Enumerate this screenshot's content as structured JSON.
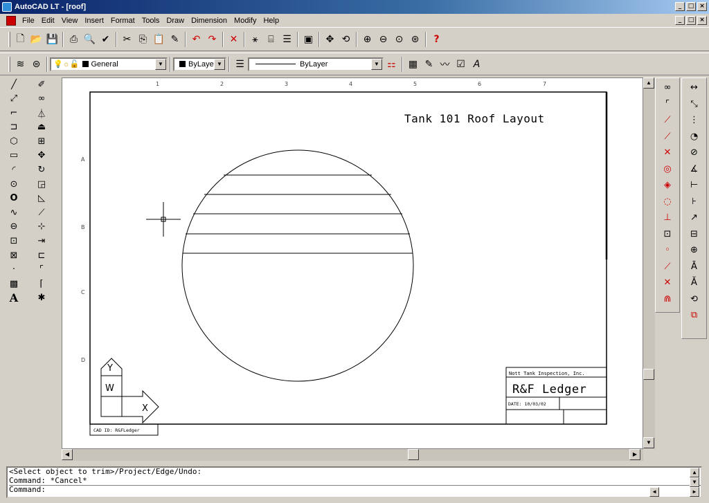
{
  "window": {
    "title": "AutoCAD LT - [roof]"
  },
  "menubar": {
    "items": [
      "File",
      "Edit",
      "View",
      "Insert",
      "Format",
      "Tools",
      "Draw",
      "Dimension",
      "Modify",
      "Help"
    ]
  },
  "properties": {
    "layer": "General",
    "color": "ByLayer",
    "linetype": "ByLayer"
  },
  "drawing": {
    "title": "Tank 101 Roof Layout",
    "ruler_top": [
      "1",
      "2",
      "3",
      "4",
      "5",
      "6",
      "7"
    ],
    "ruler_left": [
      "A",
      "B",
      "C",
      "D"
    ],
    "titleblock": {
      "company": "Nott Tank Inspection, Inc.",
      "name": "R&F Ledger",
      "date": "DATE: 10/03/02"
    },
    "cad_id": "CAD ID: R&FLedger",
    "ucs": {
      "y": "Y",
      "w": "W",
      "x": "X"
    }
  },
  "command": {
    "history": [
      "<Select object to trim>/Project/Edge/Undo:",
      "Command: *Cancel*"
    ],
    "prompt": "Command:"
  },
  "icons": {
    "toolbar1": [
      "new-icon",
      "open-icon",
      "save-icon",
      "print-icon",
      "preview-icon",
      "spell-icon",
      "cut-icon",
      "copy-icon",
      "paste-icon",
      "match-props-icon",
      "undo-icon",
      "redo-icon",
      "snap-icon",
      "tracking-icon",
      "distance-icon",
      "linetype-icon",
      "aerial-view-icon",
      "pan-icon",
      "redraw-icon",
      "zoom-window-icon",
      "zoom-realtime-icon",
      "zoom-previous-icon",
      "zoom-all-icon",
      "help-icon"
    ]
  },
  "colors": {
    "titlebar": "#0a246a",
    "face": "#d4d0c8",
    "canvas": "#ffffff"
  }
}
